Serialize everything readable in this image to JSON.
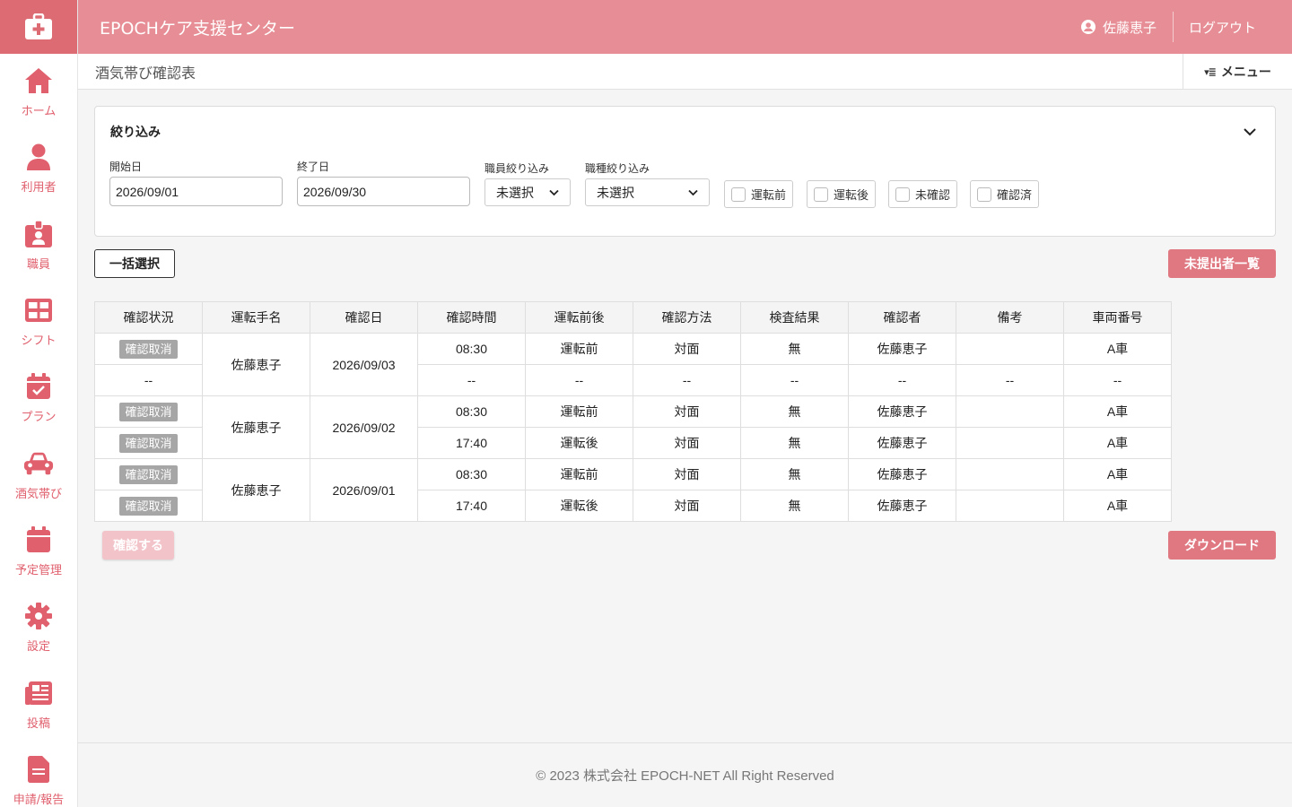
{
  "app": {
    "title": "EPOCHケア支援センター"
  },
  "colors": {
    "primary": "#e78d95",
    "accent": "#e0606e",
    "button": "#e07882"
  },
  "header": {
    "user_name": "佐藤恵子",
    "logout": "ログアウト"
  },
  "sidebar": {
    "items": [
      {
        "label": "ホーム",
        "icon": "home-icon"
      },
      {
        "label": "利用者",
        "icon": "person-icon"
      },
      {
        "label": "職員",
        "icon": "badge-icon"
      },
      {
        "label": "シフト",
        "icon": "grid-icon"
      },
      {
        "label": "プラン",
        "icon": "calendar-check-icon"
      },
      {
        "label": "酒気帯び",
        "icon": "car-icon"
      },
      {
        "label": "予定管理",
        "icon": "calendar-icon"
      },
      {
        "label": "設定",
        "icon": "gear-icon"
      },
      {
        "label": "投稿",
        "icon": "newspaper-icon"
      },
      {
        "label": "申請/報告",
        "icon": "document-icon"
      }
    ]
  },
  "page": {
    "title": "酒気帯び確認表",
    "menu_label": "メニュー"
  },
  "filter": {
    "title": "絞り込み",
    "start_label": "開始日",
    "start_value": "2026/09/01",
    "end_label": "終了日",
    "end_value": "2026/09/30",
    "staff_label": "職員絞り込み",
    "staff_value": "未選択",
    "job_label": "職種絞り込み",
    "job_value": "未選択",
    "checkboxes": [
      "運転前",
      "運転後",
      "未確認",
      "確認済"
    ]
  },
  "actions": {
    "bulk_select": "一括選択",
    "unsubmitted_list": "未提出者一覧",
    "confirm": "確認する",
    "download": "ダウンロード"
  },
  "table": {
    "headers": [
      "確認状況",
      "運転手名",
      "確認日",
      "確認時間",
      "運転前後",
      "確認方法",
      "検査結果",
      "確認者",
      "備考",
      "車両番号"
    ],
    "cancel_label": "確認取消",
    "groups": [
      {
        "driver": "佐藤恵子",
        "date": "2026/09/03",
        "rows": [
          {
            "status": "確認取消",
            "time": "08:30",
            "phase": "運転前",
            "method": "対面",
            "result": "無",
            "checker": "佐藤恵子",
            "note": "",
            "vehicle": "A車"
          },
          {
            "status": "--",
            "time": "--",
            "phase": "--",
            "method": "--",
            "result": "--",
            "checker": "--",
            "note": "--",
            "vehicle": "--"
          }
        ]
      },
      {
        "driver": "佐藤恵子",
        "date": "2026/09/02",
        "rows": [
          {
            "status": "確認取消",
            "time": "08:30",
            "phase": "運転前",
            "method": "対面",
            "result": "無",
            "checker": "佐藤恵子",
            "note": "",
            "vehicle": "A車"
          },
          {
            "status": "確認取消",
            "time": "17:40",
            "phase": "運転後",
            "method": "対面",
            "result": "無",
            "checker": "佐藤恵子",
            "note": "",
            "vehicle": "A車"
          }
        ]
      },
      {
        "driver": "佐藤恵子",
        "date": "2026/09/01",
        "rows": [
          {
            "status": "確認取消",
            "time": "08:30",
            "phase": "運転前",
            "method": "対面",
            "result": "無",
            "checker": "佐藤恵子",
            "note": "",
            "vehicle": "A車"
          },
          {
            "status": "確認取消",
            "time": "17:40",
            "phase": "運転後",
            "method": "対面",
            "result": "無",
            "checker": "佐藤恵子",
            "note": "",
            "vehicle": "A車"
          }
        ]
      }
    ]
  },
  "footer": {
    "copyright": "© 2023 株式会社 EPOCH-NET All Right Reserved"
  }
}
